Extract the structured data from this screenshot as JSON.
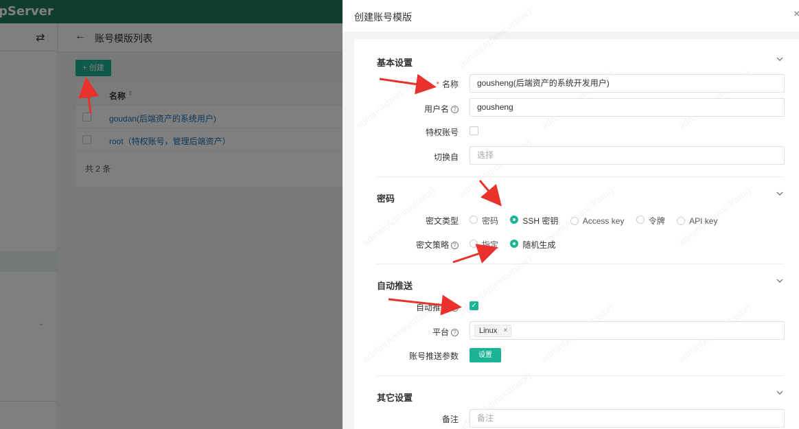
{
  "app": {
    "brand": "pServer",
    "page_title": "账号模版列表",
    "create_button": "+ 创建"
  },
  "table": {
    "header_name": "名称",
    "rows": [
      "goudan(后端资产的系统用户)",
      "root（特权账号，管理后端资产）"
    ],
    "total": "共 2 条"
  },
  "drawer": {
    "title": "创建账号模版",
    "sections": {
      "basic": {
        "title": "基本设置",
        "name_label": "名称",
        "name_value": "gousheng(后端资产的系统开发用户)",
        "username_label": "用户名",
        "username_value": "gousheng",
        "privileged_label": "特权账号",
        "switch_label": "切换自",
        "switch_placeholder": "选择"
      },
      "password": {
        "title": "密码",
        "secret_type_label": "密文类型",
        "secret_types": [
          "密码",
          "SSH 密钥",
          "Access key",
          "令牌",
          "API key"
        ],
        "secret_type_selected": "SSH 密钥",
        "strategy_label": "密文策略",
        "strategies": [
          "指定",
          "随机生成"
        ],
        "strategy_selected": "随机生成"
      },
      "push": {
        "title": "自动推送",
        "auto_push_label": "自动推送",
        "auto_push_checked": true,
        "platform_label": "平台",
        "platform_tag": "Linux",
        "params_label": "账号推送参数",
        "params_button": "设置"
      },
      "other": {
        "title": "其它设置",
        "comment_label": "备注",
        "comment_placeholder": "备注"
      }
    }
  },
  "watermark_text": "admin(Administrator)",
  "colors": {
    "brand": "#1f7a5c",
    "accent": "#1ab394",
    "annotation_arrow": "#e8322b"
  }
}
